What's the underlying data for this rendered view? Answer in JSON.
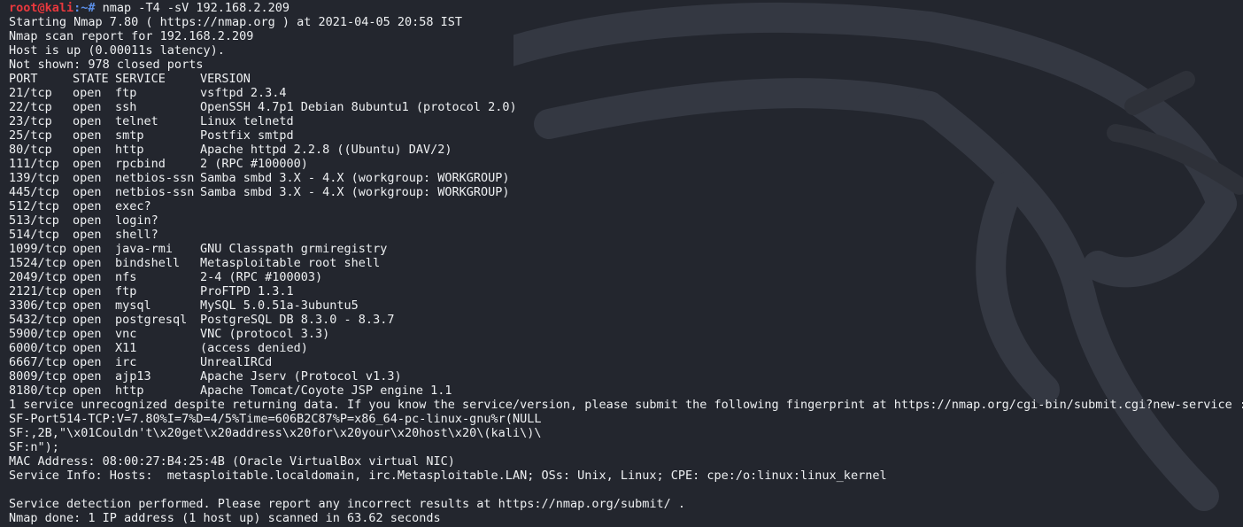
{
  "prompt": {
    "user_host": "root@kali",
    "separator": ":~# ",
    "command": "nmap -T4 -sV 192.168.2.209"
  },
  "header_lines": [
    "Starting Nmap 7.80 ( https://nmap.org ) at 2021-04-05 20:58 IST",
    "Nmap scan report for 192.168.2.209",
    "Host is up (0.00011s latency).",
    "Not shown: 978 closed ports"
  ],
  "table": {
    "columns": [
      "PORT",
      "STATE",
      "SERVICE",
      "VERSION"
    ],
    "rows": [
      [
        "21/tcp",
        "open",
        "ftp",
        "vsftpd 2.3.4"
      ],
      [
        "22/tcp",
        "open",
        "ssh",
        "OpenSSH 4.7p1 Debian 8ubuntu1 (protocol 2.0)"
      ],
      [
        "23/tcp",
        "open",
        "telnet",
        "Linux telnetd"
      ],
      [
        "25/tcp",
        "open",
        "smtp",
        "Postfix smtpd"
      ],
      [
        "80/tcp",
        "open",
        "http",
        "Apache httpd 2.2.8 ((Ubuntu) DAV/2)"
      ],
      [
        "111/tcp",
        "open",
        "rpcbind",
        "2 (RPC #100000)"
      ],
      [
        "139/tcp",
        "open",
        "netbios-ssn",
        "Samba smbd 3.X - 4.X (workgroup: WORKGROUP)"
      ],
      [
        "445/tcp",
        "open",
        "netbios-ssn",
        "Samba smbd 3.X - 4.X (workgroup: WORKGROUP)"
      ],
      [
        "512/tcp",
        "open",
        "exec?",
        ""
      ],
      [
        "513/tcp",
        "open",
        "login?",
        ""
      ],
      [
        "514/tcp",
        "open",
        "shell?",
        ""
      ],
      [
        "1099/tcp",
        "open",
        "java-rmi",
        "GNU Classpath grmiregistry"
      ],
      [
        "1524/tcp",
        "open",
        "bindshell",
        "Metasploitable root shell"
      ],
      [
        "2049/tcp",
        "open",
        "nfs",
        "2-4 (RPC #100003)"
      ],
      [
        "2121/tcp",
        "open",
        "ftp",
        "ProFTPD 1.3.1"
      ],
      [
        "3306/tcp",
        "open",
        "mysql",
        "MySQL 5.0.51a-3ubuntu5"
      ],
      [
        "5432/tcp",
        "open",
        "postgresql",
        "PostgreSQL DB 8.3.0 - 8.3.7"
      ],
      [
        "5900/tcp",
        "open",
        "vnc",
        "VNC (protocol 3.3)"
      ],
      [
        "6000/tcp",
        "open",
        "X11",
        "(access denied)"
      ],
      [
        "6667/tcp",
        "open",
        "irc",
        "UnrealIRCd"
      ],
      [
        "8009/tcp",
        "open",
        "ajp13",
        "Apache Jserv (Protocol v1.3)"
      ],
      [
        "8180/tcp",
        "open",
        "http",
        "Apache Tomcat/Coyote JSP engine 1.1"
      ]
    ]
  },
  "footer_lines": [
    "1 service unrecognized despite returning data. If you know the service/version, please submit the following fingerprint at https://nmap.org/cgi-bin/submit.cgi?new-service :",
    "SF-Port514-TCP:V=7.80%I=7%D=4/5%Time=606B2C87%P=x86_64-pc-linux-gnu%r(NULL",
    "SF:,2B,\"\\x01Couldn't\\x20get\\x20address\\x20for\\x20your\\x20host\\x20\\(kali\\)\\",
    "SF:n\");",
    "MAC Address: 08:00:27:B4:25:4B (Oracle VirtualBox virtual NIC)",
    "Service Info: Hosts:  metasploitable.localdomain, irc.Metasploitable.LAN; OSs: Unix, Linux; CPE: cpe:/o:linux:linux_kernel",
    "",
    "Service detection performed. Please report any incorrect results at https://nmap.org/submit/ .",
    "Nmap done: 1 IP address (1 host up) scanned in 63.62 seconds"
  ],
  "colors": {
    "background": "#23262e",
    "text": "#eef0f2",
    "prompt_user": "#e8383d",
    "prompt_dir": "#5b8fe8"
  },
  "icons": {
    "watermark": "kali-dragon-icon"
  }
}
